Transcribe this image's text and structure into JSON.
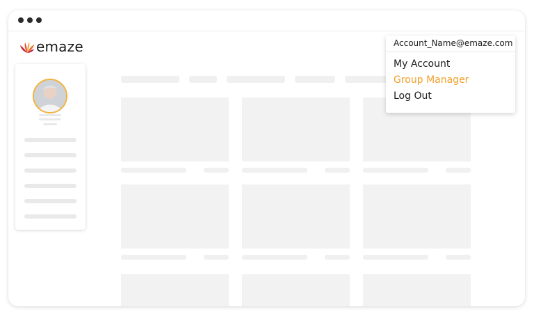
{
  "app": {
    "logo_text": "emaze"
  },
  "account_menu": {
    "email": "Account_Name@emaze.com",
    "items": [
      {
        "label": "My Account",
        "color": "#1c1c1c"
      },
      {
        "label": "Group Manager",
        "color": "#f0a02a"
      },
      {
        "label": "Log Out",
        "color": "#1c1c1c"
      }
    ]
  },
  "colors": {
    "accent": "#f0a02a",
    "avatar_ring": "#f2b33d",
    "skeleton": "#f0f0f0"
  },
  "icons": {
    "window_controls": "three-dots",
    "logo": "emaze-flame-logo"
  }
}
